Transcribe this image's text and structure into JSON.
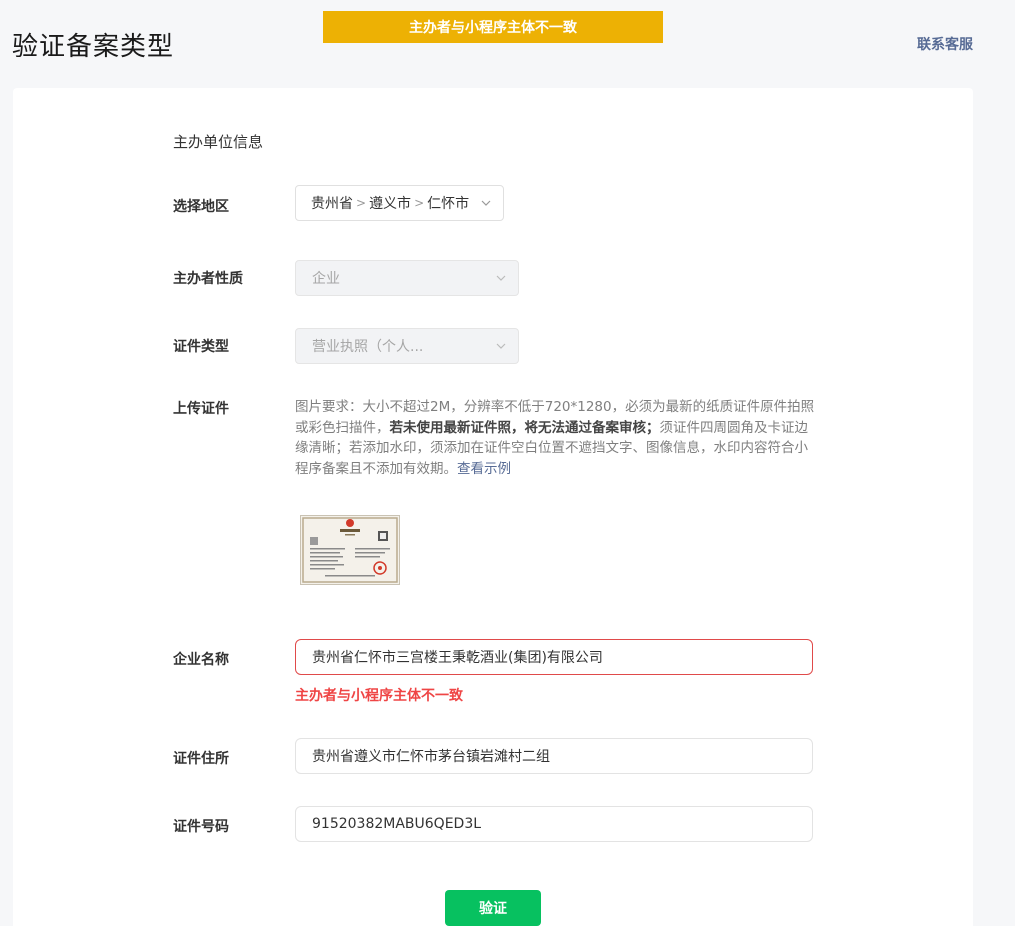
{
  "page": {
    "title": "验证备案类型",
    "alert": "主办者与小程序主体不一致",
    "contact_link": "联系客服"
  },
  "form": {
    "section_title": "主办单位信息",
    "region": {
      "label": "选择地区",
      "province": "贵州省",
      "city": "遵义市",
      "county": "仁怀市",
      "separator": ">"
    },
    "organizer_type": {
      "label": "主办者性质",
      "value": "企业"
    },
    "certificate_type": {
      "label": "证件类型",
      "value": "营业执照（个人..."
    },
    "upload": {
      "label": "上传证件",
      "desc_part1": "图片要求：大小不超过2M，分辨率不低于720*1280，必须为最新的纸质证件原件拍照或彩色扫描件，",
      "desc_bold": "若未使用最新证件照，将无法通过备案审核；",
      "desc_part2": "须证件四周圆角及卡证边缘清晰；若添加水印，须添加在证件空白位置不遮挡文字、图像信息，水印内容符合小程序备案且不添加有效期。",
      "example_link": "查看示例",
      "thumbnail_icon": "business-license-image"
    },
    "company_name": {
      "label": "企业名称",
      "value": "贵州省仁怀市三宫楼王秉乾酒业(集团)有限公司",
      "error": "主办者与小程序主体不一致"
    },
    "address": {
      "label": "证件住所",
      "value": "贵州省遵义市仁怀市茅台镇岩滩村二组"
    },
    "cert_number": {
      "label": "证件号码",
      "value": "91520382MABU6QED3L"
    },
    "submit_label": "验证"
  },
  "colors": {
    "alert_bg": "#edb104",
    "link": "#576b95",
    "error": "#ef4545",
    "primary_button": "#07c160"
  }
}
